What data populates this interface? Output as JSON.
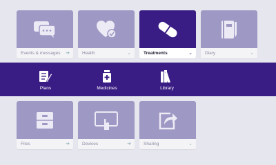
{
  "tiles": {
    "events": {
      "label": "Events & messages",
      "icon": "chat-bubbles-icon",
      "indicator": "arrow-right"
    },
    "health": {
      "label": "Health",
      "icon": "heart-check-icon",
      "indicator": "chevron-down"
    },
    "treatments": {
      "label": "Treatments",
      "icon": "pill-icon",
      "indicator": "chevron-down",
      "active": true
    },
    "diary": {
      "label": "Diary",
      "icon": "notebook-icon",
      "indicator": "chevron-down"
    },
    "files": {
      "label": "Files",
      "icon": "cabinet-icon",
      "indicator": "arrow-right"
    },
    "devices": {
      "label": "Devices",
      "icon": "tablet-touch-icon",
      "indicator": "arrow-right"
    },
    "sharing": {
      "label": "Sharing",
      "icon": "share-icon",
      "indicator": "chevron-down"
    }
  },
  "submenu": {
    "plans": {
      "label": "Plans",
      "icon": "checklist-icon"
    },
    "medicines": {
      "label": "Medicines",
      "icon": "medicine-bottle-icon"
    },
    "library": {
      "label": "Library",
      "icon": "books-icon"
    }
  },
  "colors": {
    "accent": "#3a1d84",
    "tile_art": "#9e98c4",
    "tile_bar": "#f4f4f7",
    "background": "#e6e6ee",
    "indicator": "#8fb3b8"
  }
}
